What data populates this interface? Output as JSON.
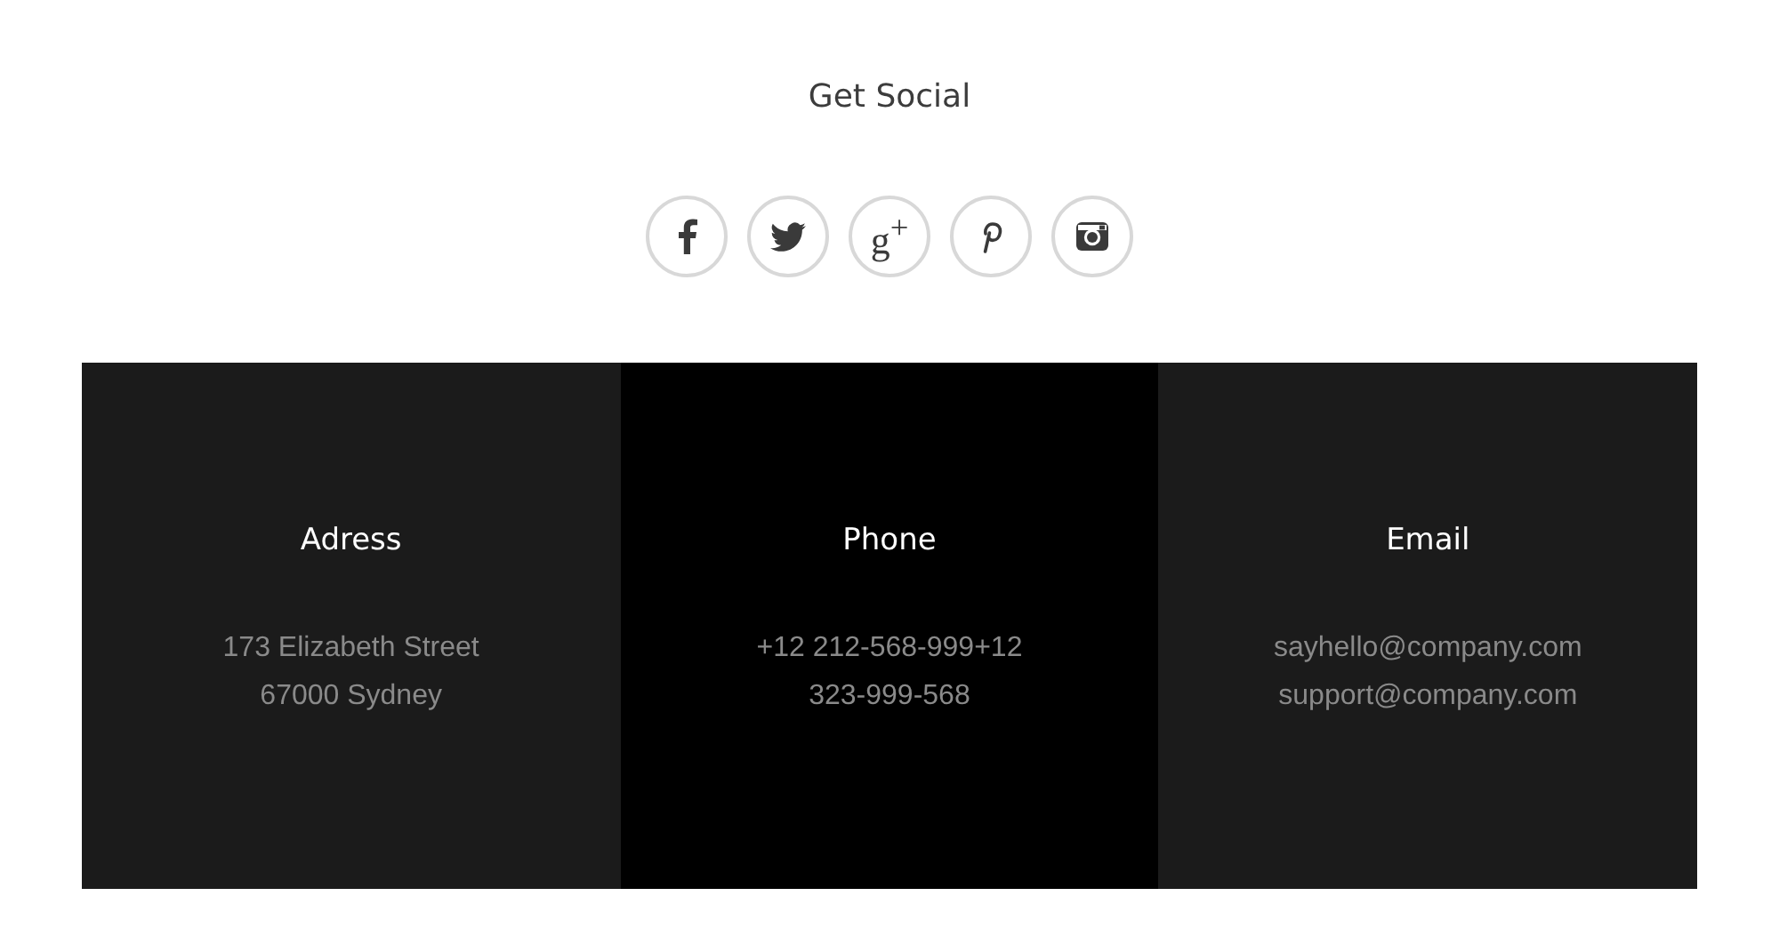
{
  "social": {
    "title": "Get Social",
    "links": [
      {
        "kind": "facebook"
      },
      {
        "kind": "twitter"
      },
      {
        "kind": "googleplus",
        "text": "g$^{+}$"
      },
      {
        "kind": "pinterest"
      },
      {
        "kind": "instagram"
      }
    ]
  },
  "contacts": [
    {
      "title": "Adress",
      "color": "#1b1b1b",
      "lines": [
        "173 Elizabeth Street",
        "67000 Sydney"
      ]
    },
    {
      "title": "Phone",
      "color": "#000000",
      "lines": [
        "+12 212-568-999+12",
        "323-999-568"
      ]
    },
    {
      "title": "Email",
      "color": "#1b1b1b",
      "lines": [
        "sayhello@company.com",
        "support@company.com"
      ]
    }
  ]
}
